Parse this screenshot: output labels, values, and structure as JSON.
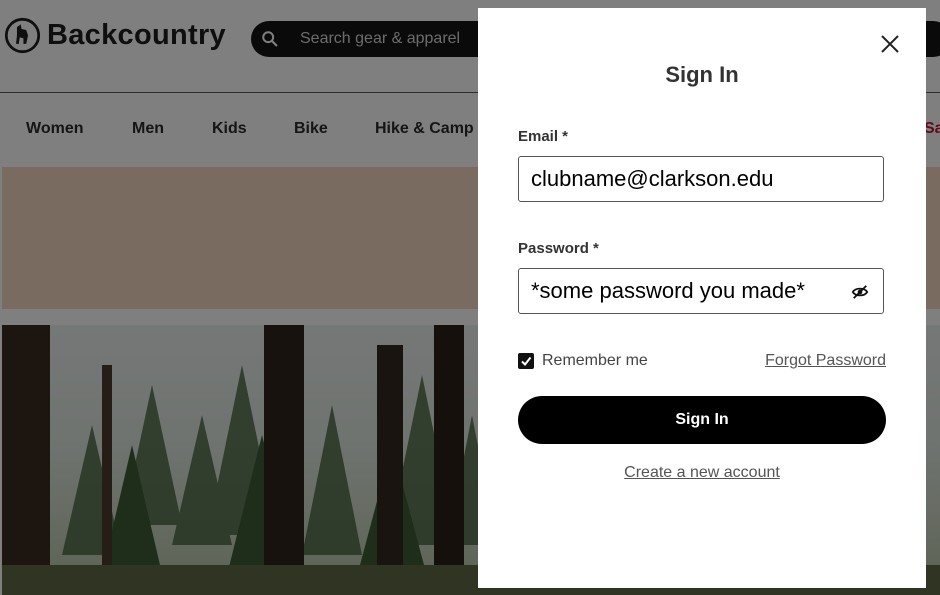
{
  "site": {
    "brand": "Backcountry",
    "search": {
      "placeholder": "Search gear & apparel"
    },
    "nav": {
      "items": [
        "Women",
        "Men",
        "Kids",
        "Bike",
        "Hike & Camp"
      ],
      "sale_label": "Sa"
    }
  },
  "modal": {
    "title": "Sign In",
    "email": {
      "label": "Email *",
      "value": "clubname@clarkson.edu"
    },
    "password": {
      "label": "Password *",
      "value": "*some password you made*"
    },
    "remember_me": {
      "label": "Remember me",
      "checked": true
    },
    "forgot_password_label": "Forgot Password",
    "submit_label": "Sign In",
    "create_account_label": "Create a new account"
  },
  "icons": {
    "logo": "backcountry-goat-logo-icon",
    "search": "search-icon",
    "close": "close-icon",
    "password_visibility": "eye-slash-icon",
    "checkbox": "checkmark-icon"
  },
  "colors": {
    "overlay": "rgba(0,0,0,0.5)",
    "search_bar": "#151515",
    "primary_button": "#000000",
    "sale_accent": "#c8102e",
    "promo_banner": "#f3d7c0"
  }
}
